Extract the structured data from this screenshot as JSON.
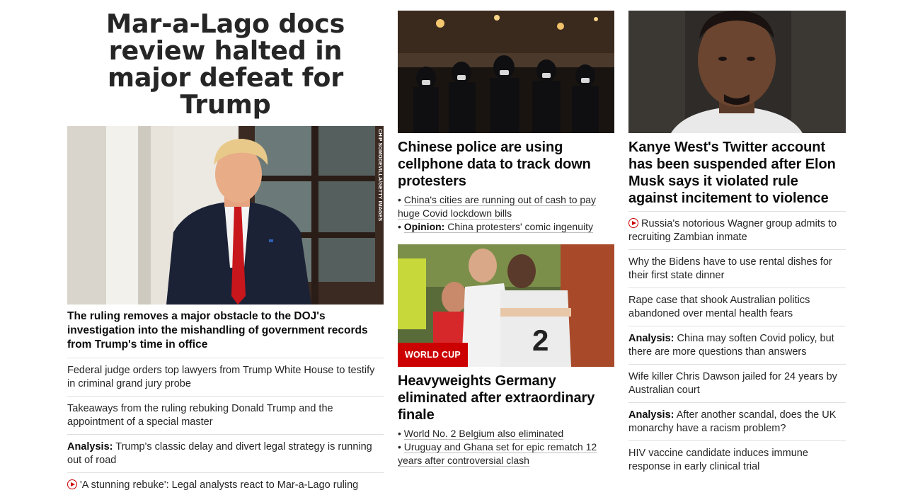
{
  "lead": {
    "title": "Mar-a-Lago docs review halted in major defeat for Trump",
    "photo_credit": "CHIP SOMODEVILLA/GETTY IMAGES",
    "summary": "The ruling removes a major obstacle to the DOJ's investigation into the mishandling of government records from Trump's time in office",
    "links": [
      {
        "prefix": "",
        "text": "Federal judge orders top lawyers from Trump White House to testify in criminal grand jury probe",
        "video": false
      },
      {
        "prefix": "",
        "text": "Takeaways from the ruling rebuking Donald Trump and the appointment of a special master",
        "video": false
      },
      {
        "prefix": "Analysis:",
        "text": "Trump's classic delay and divert legal strategy is running out of road",
        "video": false
      },
      {
        "prefix": "",
        "text": "'A stunning rebuke': Legal analysts react to Mar-a-Lago ruling",
        "video": true
      }
    ]
  },
  "china": {
    "headline": "Chinese police are using cellphone data to track down protesters",
    "sub": [
      {
        "prefix": "",
        "text": "China's cities are running out of cash to pay huge Covid lockdown bills"
      },
      {
        "prefix": "Opinion:",
        "text": "China protesters' comic ingenuity"
      }
    ]
  },
  "worldcup": {
    "badge": "WORLD CUP",
    "headline": "Heavyweights Germany eliminated after extraordinary finale",
    "sub": [
      {
        "prefix": "",
        "text": "World No. 2 Belgium also eliminated"
      },
      {
        "prefix": "",
        "text": "Uruguay and Ghana set for epic rematch 12 years after controversial clash"
      }
    ]
  },
  "kanye": {
    "headline": "Kanye West's Twitter account has been suspended after Elon Musk says it violated rule against incitement to violence",
    "links": [
      {
        "prefix": "",
        "text": "Russia's notorious Wagner group admits to recruiting Zambian inmate",
        "video": true
      },
      {
        "prefix": "",
        "text": "Why the Bidens have to use rental dishes for their first state dinner",
        "video": false
      },
      {
        "prefix": "",
        "text": "Rape case that shook Australian politics abandoned over mental health fears",
        "video": false
      },
      {
        "prefix": "Analysis:",
        "text": "China may soften Covid policy, but there are more questions than answers",
        "video": false
      },
      {
        "prefix": "",
        "text": "Wife killer Chris Dawson jailed for 24 years by Australian court",
        "video": false
      },
      {
        "prefix": "Analysis:",
        "text": "After another scandal, does the UK monarchy have a racism problem?",
        "video": false
      },
      {
        "prefix": "",
        "text": "HIV vaccine candidate induces immune response in early clinical trial",
        "video": false
      }
    ]
  },
  "colors": {
    "accent": "#cc0000",
    "divider": "#e0e0e0",
    "text": "#0c0c0c"
  }
}
